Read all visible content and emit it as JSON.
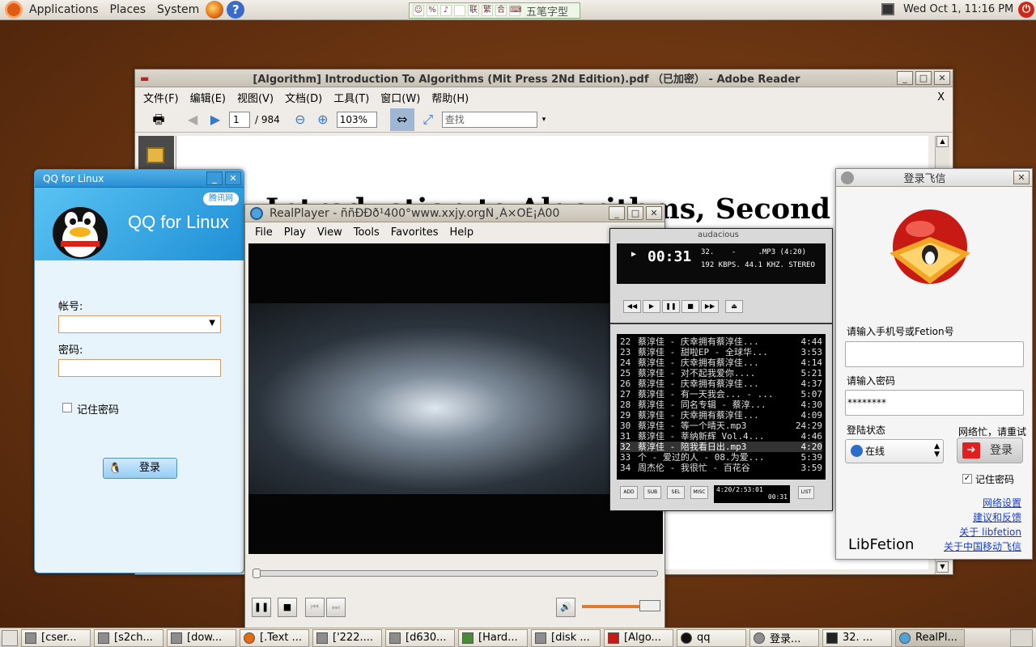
{
  "top_panel": {
    "menus": [
      "Applications",
      "Places",
      "System"
    ],
    "ime_label": "五笔字型",
    "ime_cells": [
      "☺",
      "%",
      "♪",
      "",
      "联",
      "繁",
      "合",
      "⌨"
    ],
    "clock": "Wed Oct  1, 11:16 PM"
  },
  "adobe": {
    "title": "[Algorithm] Introduction To Algorithms (Mit Press 2Nd Edition).pdf （已加密） - Adobe Reader",
    "menus": [
      "文件(F)",
      "编辑(E)",
      "视图(V)",
      "文档(D)",
      "工具(T)",
      "窗口(W)",
      "帮助(H)"
    ],
    "close_x": "X",
    "page_current": "1",
    "page_total": "/ 984",
    "zoom": "103%",
    "search_placeholder": "查找",
    "doc_title": "Introduction to Algorithms, Second Edition"
  },
  "qq": {
    "title": "QQ for Linux",
    "banner_title": "QQ for Linux",
    "logo_text": "腾讯网",
    "account_label": "帐号:",
    "password_label": "密码:",
    "remember_label": "记住密码",
    "login_button": "登录"
  },
  "realplayer": {
    "title": "RealPlayer - ññÐÐð¹400°www.xxjy.orgÑ¸À×ÖÉ¡À00",
    "menus": [
      "File",
      "Play",
      "View",
      "Tools",
      "Favorites",
      "Help"
    ]
  },
  "audacious": {
    "logo": "audacious",
    "time": "00:31",
    "track_line": "32.    -     .MP3 (4:20)",
    "format_line": "192 KBPS. 44.1 KHZ. STEREO",
    "playlist": [
      {
        "n": "22",
        "t": "蔡淳佳 - 庆幸拥有蔡淳佳...",
        "d": "4:44"
      },
      {
        "n": "23",
        "t": "蔡淳佳 - 甜啦EP - 全球华...",
        "d": "3:53"
      },
      {
        "n": "24",
        "t": "蔡淳佳 - 庆幸拥有蔡淳佳...",
        "d": "4:14"
      },
      {
        "n": "25",
        "t": "蔡淳佳 - 对不起我爱你....",
        "d": "5:21"
      },
      {
        "n": "26",
        "t": "蔡淳佳 - 庆幸拥有蔡淳佳...",
        "d": "4:37"
      },
      {
        "n": "27",
        "t": "蔡淳佳 - 有一天我会... - ...",
        "d": "5:07"
      },
      {
        "n": "28",
        "t": "蔡淳佳 - 同名专辑 - 蔡淳...",
        "d": "4:30"
      },
      {
        "n": "29",
        "t": "蔡淳佳 - 庆幸拥有蔡淳佳...",
        "d": "4:09"
      },
      {
        "n": "30",
        "t": "蔡淳佳 - 等一个晴天.mp3",
        "d": "24:29"
      },
      {
        "n": "31",
        "t": "蔡淳佳 - 莘纳新辉 Vol.4...",
        "d": "4:46"
      },
      {
        "n": "32",
        "t": "蔡淳佳 - 陪我看日出.mp3",
        "d": "4:20"
      },
      {
        "n": "33",
        "t": "个 - 爱过的人 - 08.为爱...",
        "d": "5:39"
      },
      {
        "n": "34",
        "t": "周杰伦 - 我很忙 - 百花谷",
        "d": "3:59"
      }
    ],
    "selected_index": 10,
    "buttons": [
      "ADD",
      "SUB",
      "SEL",
      "MISC"
    ],
    "list_button": "LIST",
    "position": "4:20/2:53:01",
    "mini_time": "00:31"
  },
  "fetion": {
    "title": "登录飞信",
    "phone_label": "请输入手机号或Fetion号",
    "phone_value": "",
    "password_label": "请输入密码",
    "password_value": "********",
    "status_label": "登陆状态",
    "status_value": "在线",
    "network_msg": "网络忙，请重试",
    "login_button": "登录",
    "remember_label": "记住密码",
    "links": [
      "网络设置",
      "建议和反馈",
      "关于 libfetion",
      "关于中国移动飞信"
    ],
    "brand": "LibFetion"
  },
  "taskbar": {
    "tasks": [
      "[cser...",
      "[s2ch...",
      "[dow...",
      "[.Text ...",
      "['222....",
      "[d630...",
      "[Hard...",
      "[disk ...",
      "[Algo...",
      "qq",
      "登录...",
      "32. ...",
      "RealPl..."
    ]
  }
}
